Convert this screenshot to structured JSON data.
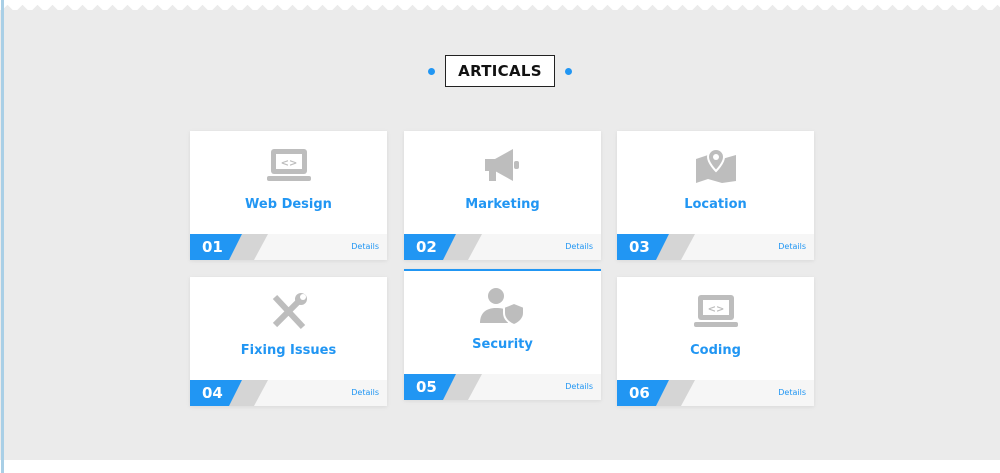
{
  "section_title": "ARTICALS",
  "accent": "#2196f3",
  "cards": [
    {
      "number": "01",
      "title": "Web Design",
      "icon": "laptop-code-icon",
      "link": "Details"
    },
    {
      "number": "02",
      "title": "Marketing",
      "icon": "megaphone-icon",
      "link": "Details"
    },
    {
      "number": "03",
      "title": "Location",
      "icon": "map-icon",
      "link": "Details"
    },
    {
      "number": "04",
      "title": "Fixing Issues",
      "icon": "tools-icon",
      "link": "Details"
    },
    {
      "number": "05",
      "title": "Security",
      "icon": "user-shield-icon",
      "link": "Details"
    },
    {
      "number": "06",
      "title": "Coding",
      "icon": "laptop-code-icon",
      "link": "Details"
    }
  ]
}
